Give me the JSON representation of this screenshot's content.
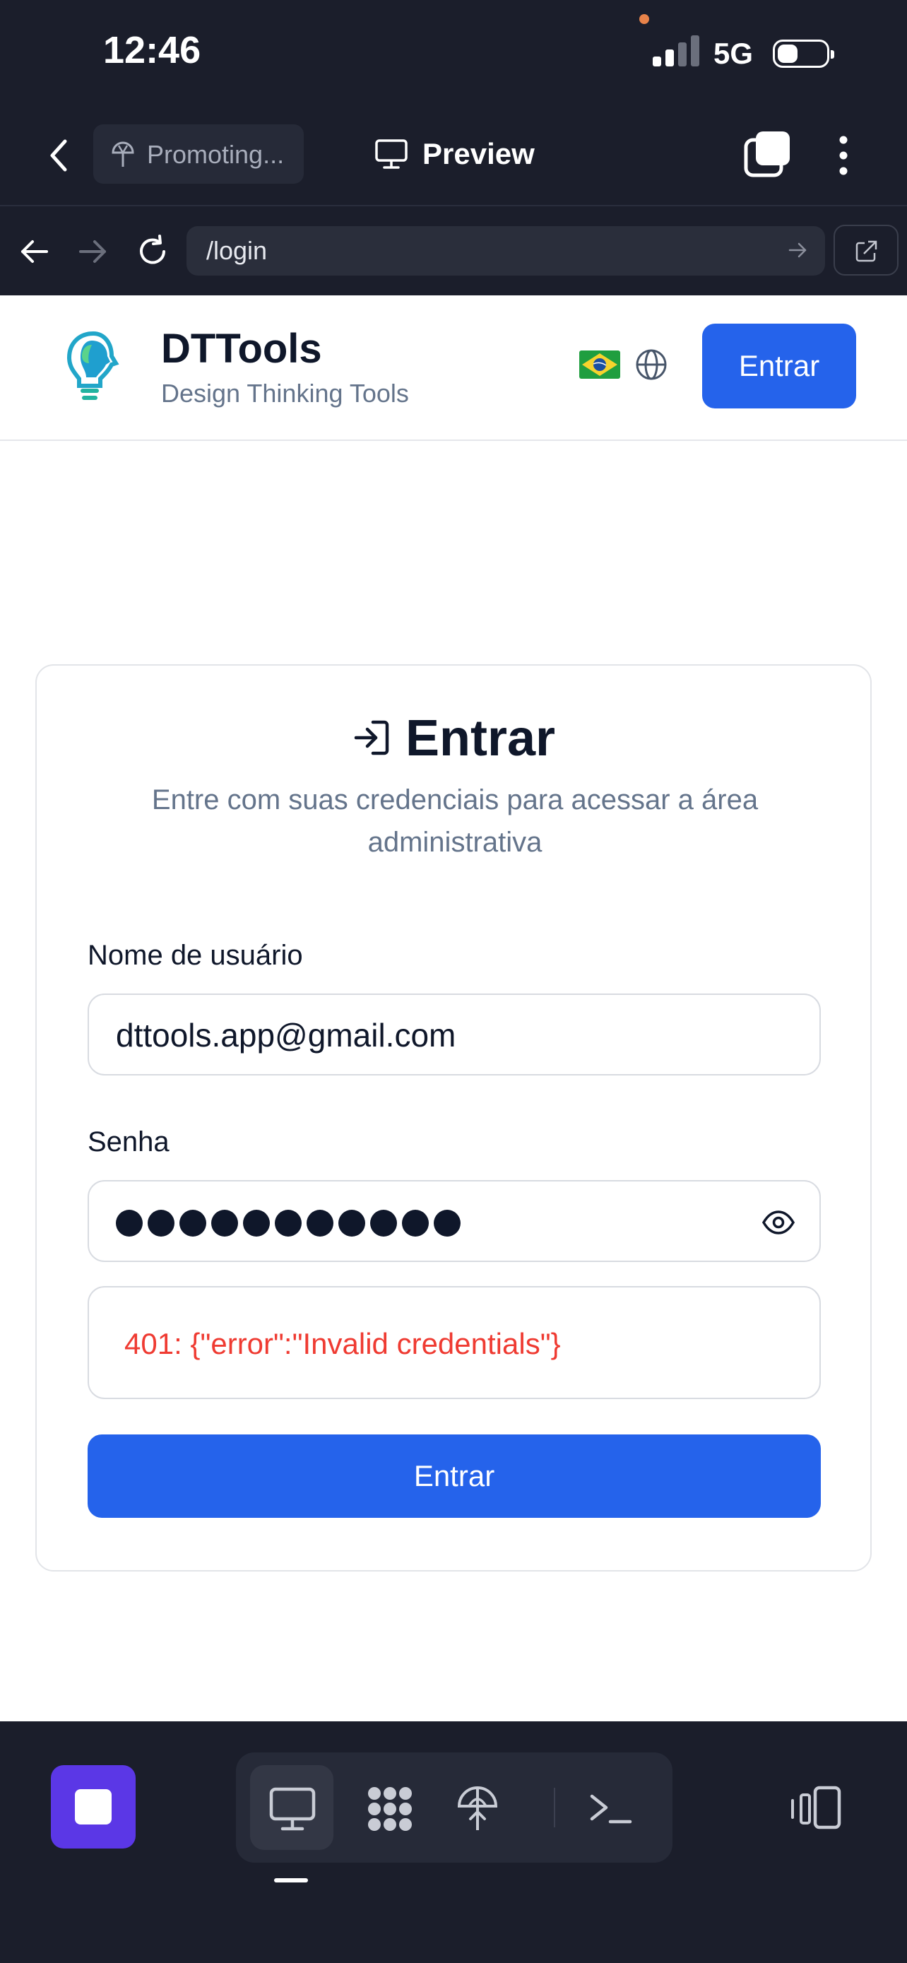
{
  "status_bar": {
    "time": "12:46",
    "network": "5G"
  },
  "app_bar": {
    "project_label": "Promoting...",
    "preview_label": "Preview"
  },
  "browser": {
    "url": "/login"
  },
  "site": {
    "title": "DTTools",
    "subtitle": "Design Thinking Tools",
    "header_button": "Entrar"
  },
  "login": {
    "title": "Entrar",
    "description": "Entre com suas credenciais para acessar a área administrativa",
    "username_label": "Nome de usuário",
    "username_value": "dttools.app@gmail.com",
    "password_label": "Senha",
    "password_mask_length": 11,
    "error_message": "401: {\"error\":\"Invalid credentials\"}",
    "submit_label": "Entrar"
  },
  "colors": {
    "primary": "#2563eb",
    "error": "#ef3b32",
    "dark_bg": "#1b1e2b",
    "stop_button": "#5b37e6"
  }
}
